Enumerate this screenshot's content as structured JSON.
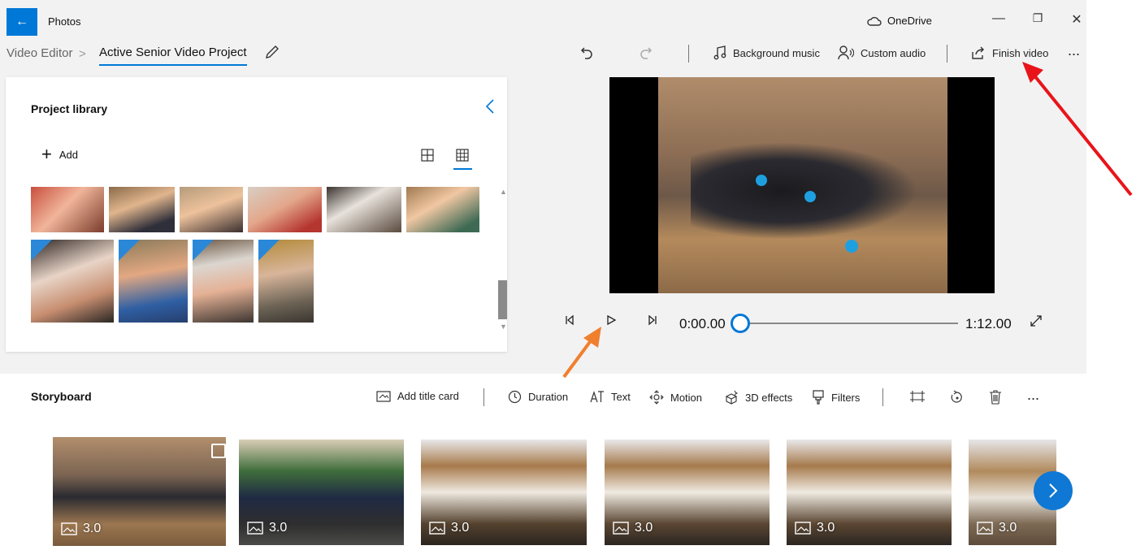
{
  "app": {
    "title": "Photos",
    "onedrive_label": "OneDrive"
  },
  "breadcrumb": {
    "root": "Video Editor",
    "separator": ">",
    "project": "Active Senior Video Project"
  },
  "toolbar": {
    "background_music": "Background music",
    "custom_audio": "Custom audio",
    "finish_video": "Finish video",
    "more": "..."
  },
  "library": {
    "title": "Project library",
    "add_label": "Add",
    "photos_row1": [
      "portrait-1",
      "portrait-2",
      "portrait-3",
      "portrait-4",
      "portrait-5",
      "portrait-6"
    ],
    "photos_row2": [
      "portrait-7",
      "portrait-8",
      "portrait-9",
      "portrait-10"
    ]
  },
  "player": {
    "current_time": "0:00.00",
    "total_time": "1:12.00",
    "progress": 0
  },
  "storyboard": {
    "title": "Storyboard",
    "add_title_card": "Add title card",
    "duration": "Duration",
    "text": "Text",
    "motion": "Motion",
    "effects_3d": "3D effects",
    "filters": "Filters",
    "more": "...",
    "clips": [
      {
        "duration": "3.0"
      },
      {
        "duration": "3.0"
      },
      {
        "duration": "3.0"
      },
      {
        "duration": "3.0"
      },
      {
        "duration": "3.0"
      },
      {
        "duration": "3.0"
      }
    ]
  },
  "colors": {
    "accent": "#0078d7",
    "arrow_red": "#e8141a",
    "arrow_orange": "#f07f2e"
  }
}
